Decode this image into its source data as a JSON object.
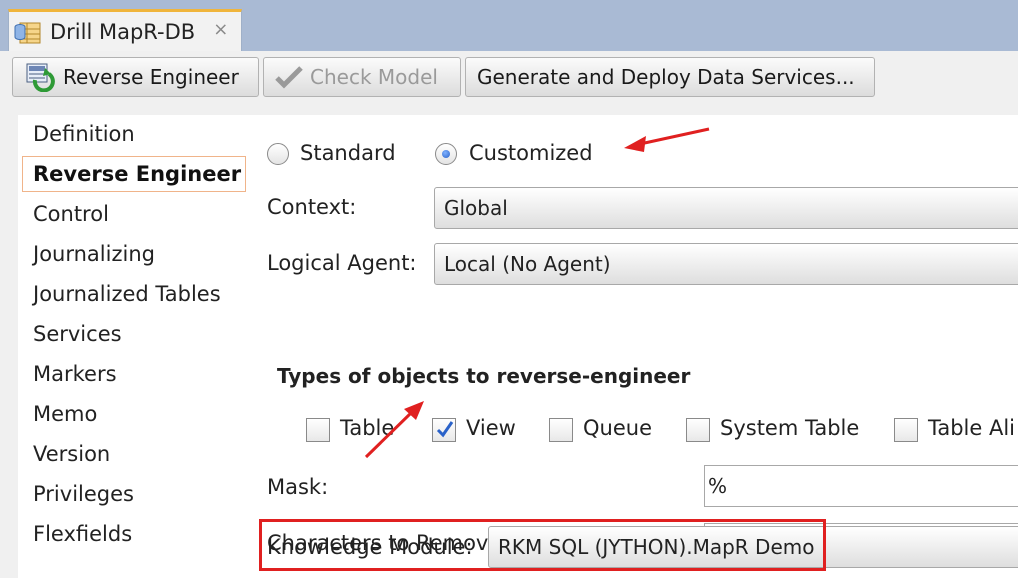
{
  "tab": {
    "title": "Drill MapR-DB",
    "close": "×",
    "icon": "datastore-icon"
  },
  "toolbar": {
    "reverse_engineer": "Reverse Engineer",
    "check_model": "Check Model",
    "generate_deploy": "Generate and Deploy Data Services..."
  },
  "sidebar": {
    "items": [
      {
        "label": "Definition"
      },
      {
        "label": "Reverse Engineer"
      },
      {
        "label": "Control"
      },
      {
        "label": "Journalizing"
      },
      {
        "label": "Journalized Tables"
      },
      {
        "label": "Services"
      },
      {
        "label": "Markers"
      },
      {
        "label": "Memo"
      },
      {
        "label": "Version"
      },
      {
        "label": "Privileges"
      },
      {
        "label": "Flexfields"
      }
    ],
    "selected": "Reverse Engineer"
  },
  "form": {
    "mode_standard": "Standard",
    "mode_customized": "Customized",
    "mode_selected": "Customized",
    "context_label": "Context:",
    "context_value": "Global",
    "agent_label": "Logical Agent:",
    "agent_value": "Local (No Agent)",
    "types_title": "Types of objects to reverse-engineer",
    "types": [
      {
        "label": "Table",
        "checked": false
      },
      {
        "label": "View",
        "checked": true
      },
      {
        "label": "Queue",
        "checked": false
      },
      {
        "label": "System Table",
        "checked": false
      },
      {
        "label": "Table Ali",
        "checked": false
      }
    ],
    "mask_label": "Mask:",
    "mask_value": "%",
    "chars_label": "Characters to Remove from Table Alias:",
    "chars_value": "",
    "km_label": "Knowledge Module:",
    "km_value": "RKM SQL (JYTHON).MapR Demo"
  },
  "colors": {
    "annotation": "#e02020",
    "tab_accent": "#f0b53c",
    "selection_border": "#f0b48a"
  }
}
